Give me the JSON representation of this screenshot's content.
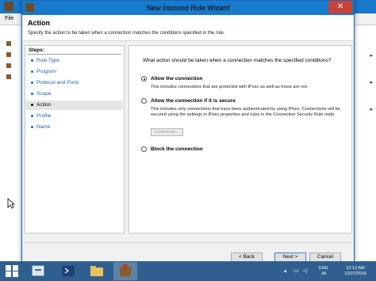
{
  "background_window": {
    "menu_label": "File"
  },
  "dialog": {
    "title": "New Inbound Rule Wizard",
    "header_title": "Action",
    "header_description": "Specify the action to be taken when a connection matches the conditions specified in the rule.",
    "steps_title": "Steps:",
    "steps": [
      {
        "label": "Rule Type",
        "active": false
      },
      {
        "label": "Program",
        "active": false
      },
      {
        "label": "Protocol and Ports",
        "active": false
      },
      {
        "label": "Scope",
        "active": false
      },
      {
        "label": "Action",
        "active": true
      },
      {
        "label": "Profile",
        "active": false
      },
      {
        "label": "Name",
        "active": false
      }
    ],
    "question": "What action should be taken when a connection matches the specified conditions?",
    "options": [
      {
        "label": "Allow the connection",
        "description": "This includes connections that are protected with IPsec as well as those are not.",
        "selected": true
      },
      {
        "label": "Allow the connection if it is secure",
        "description": "This includes only connections that have been authenticated by using IPsec.  Connections will be secured using the settings in IPsec properties and rules in the Connection Security Rule node.",
        "selected": false
      },
      {
        "label": "Block the connection",
        "description": "",
        "selected": false
      }
    ],
    "customize_label": "Customize...",
    "buttons": {
      "back": "< Back",
      "next": "Next >",
      "cancel": "Cancel"
    },
    "close_glyph": "✕"
  },
  "taskbar": {
    "language": "ENG",
    "input_mode": "JA",
    "time": "12:12 AM",
    "date": "12/27/2016"
  },
  "colors": {
    "titlebar": "#1979ca",
    "desktop": "#3a8fd3",
    "taskbar": "#2f5f8f",
    "link": "#1e5fb8",
    "close_button": "#c7443a"
  }
}
